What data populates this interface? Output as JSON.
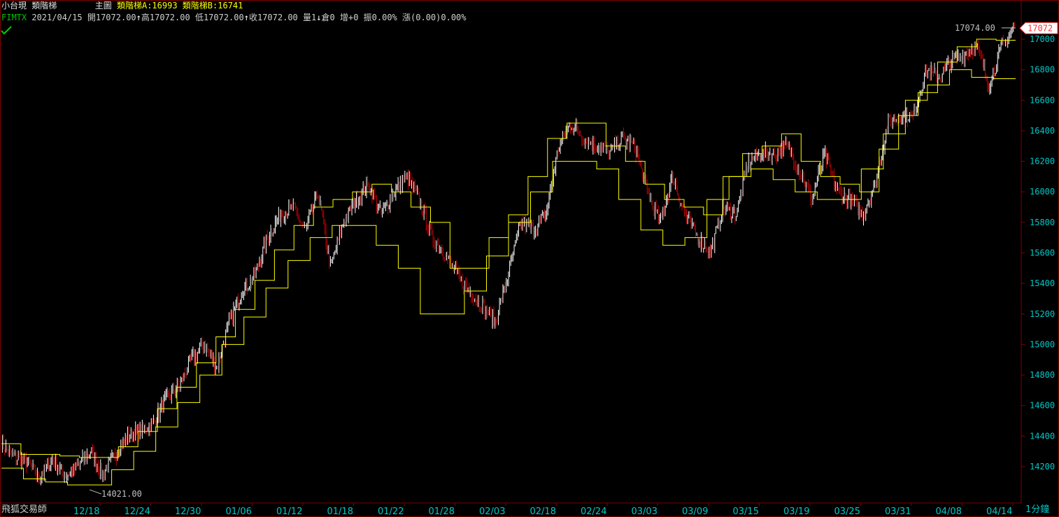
{
  "header": {
    "instrument": "小台現",
    "indicator_name": "類階梯",
    "chart_label": "主圖",
    "ladder_a_label": "類階梯A:16993",
    "ladder_b_label": "類階梯B:16741"
  },
  "quote": {
    "symbol": "FIMTX",
    "date": "2021/04/15",
    "open": "開17072.00",
    "high": "高17072.00",
    "low": "低17072.00",
    "close": "收17072.00",
    "volume": "量1",
    "oi": "倉0",
    "change_oi": "增+0",
    "amplitude": "振0.00%",
    "change": "漲(0.00)0.00%",
    "up_arrow": "↑",
    "down_arrow": "↓"
  },
  "footer": {
    "app_name": "飛狐交易師",
    "interval": "1分鐘"
  },
  "colors": {
    "background": "#000000",
    "axis": "#800000",
    "axis_text": "#00c8c8",
    "ladder": "#ffff00",
    "candle_up": "#ffffff",
    "candle_down": "#c00000",
    "last_price_box": "#ff3030"
  },
  "chart_data": {
    "type": "candlestick",
    "y_ticks": [
      14200,
      14400,
      14600,
      14800,
      15000,
      15200,
      15400,
      15600,
      15800,
      16000,
      16200,
      16400,
      16600,
      16800,
      17000
    ],
    "ylim": [
      14021,
      17074
    ],
    "x_ticks": [
      "12/18",
      "12/24",
      "12/30",
      "01/06",
      "01/12",
      "01/18",
      "01/22",
      "01/28",
      "02/03",
      "02/18",
      "02/24",
      "03/03",
      "03/09",
      "03/15",
      "03/19",
      "03/25",
      "03/31",
      "04/08",
      "04/14"
    ],
    "high_label": "17074.00",
    "low_label": "14021.00",
    "last_price": "17072",
    "last_price_value": 17072,
    "price_path": [
      14350,
      14260,
      14230,
      14120,
      14250,
      14140,
      14200,
      14300,
      14150,
      14280,
      14400,
      14440,
      14480,
      14650,
      14720,
      14900,
      15000,
      14850,
      15150,
      15350,
      15450,
      15700,
      15850,
      15900,
      15750,
      16000,
      15500,
      15800,
      15950,
      16050,
      15850,
      16000,
      16100,
      15950,
      15700,
      15600,
      15450,
      15350,
      15250,
      15150,
      15450,
      15800,
      15750,
      15850,
      16300,
      16450,
      16350,
      16300,
      16250,
      16350,
      16300,
      16000,
      15800,
      16100,
      15850,
      15700,
      15600,
      15900,
      15850,
      16200,
      16250,
      16250,
      16300,
      16150,
      15950,
      16250,
      16000,
      15950,
      15850,
      16050,
      16450,
      16500,
      16500,
      16800,
      16750,
      16850,
      16900,
      16950,
      16700,
      16950,
      17072
    ],
    "ladder_a": [
      14350,
      14280,
      14280,
      14270,
      14260,
      14260,
      14330,
      14430,
      14580,
      14720,
      14880,
      15050,
      15230,
      15420,
      15620,
      15780,
      15900,
      15950,
      16000,
      16050,
      16000,
      15900,
      15800,
      15500,
      15500,
      15700,
      15850,
      16100,
      16350,
      16450,
      16450,
      16300,
      16200,
      16050,
      15950,
      15900,
      15850,
      16100,
      16250,
      16300,
      16380,
      16200,
      16100,
      16050,
      16000,
      16280,
      16500,
      16650,
      16850,
      16950,
      17000,
      16993
    ],
    "ladder_b": [
      14190,
      14120,
      14100,
      14080,
      14080,
      14180,
      14300,
      14460,
      14620,
      14800,
      15000,
      15180,
      15370,
      15550,
      15700,
      15780,
      15780,
      15650,
      15500,
      15200,
      15200,
      15350,
      15580,
      15800,
      16000,
      16200,
      16200,
      16150,
      15950,
      15750,
      15650,
      15700,
      15950,
      16100,
      16150,
      16080,
      16000,
      15950,
      15950,
      16150,
      16380,
      16600,
      16700,
      16800,
      16750,
      16741
    ]
  }
}
